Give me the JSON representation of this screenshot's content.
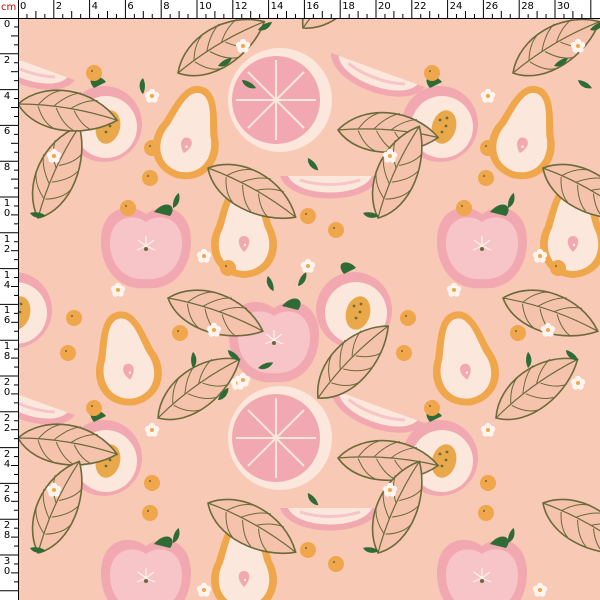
{
  "ruler": {
    "unit": "cm",
    "top_ticks": [
      "0",
      "2",
      "4",
      "6",
      "8",
      "10",
      "12",
      "14",
      "16",
      "18",
      "20",
      "22",
      "24",
      "26",
      "28",
      "30"
    ],
    "left_ticks": [
      "0",
      "2",
      "4",
      "6",
      "8",
      "10",
      "12",
      "14",
      "16",
      "18",
      "20",
      "22",
      "24",
      "26",
      "28",
      "30"
    ]
  },
  "pattern": {
    "motif": "fruit-print",
    "colors": {
      "background": "#f8c9b4",
      "pink": "#f2a8b0",
      "light-pink": "#f7c4c7",
      "cream": "#fbe7dc",
      "orange": "#f0a64a",
      "mustard": "#e9a94a",
      "leaf-outline": "#6a6a3a",
      "leaf-fill": "#f5c2ab",
      "green": "#2f6b35",
      "white": "#fff4ee"
    }
  }
}
